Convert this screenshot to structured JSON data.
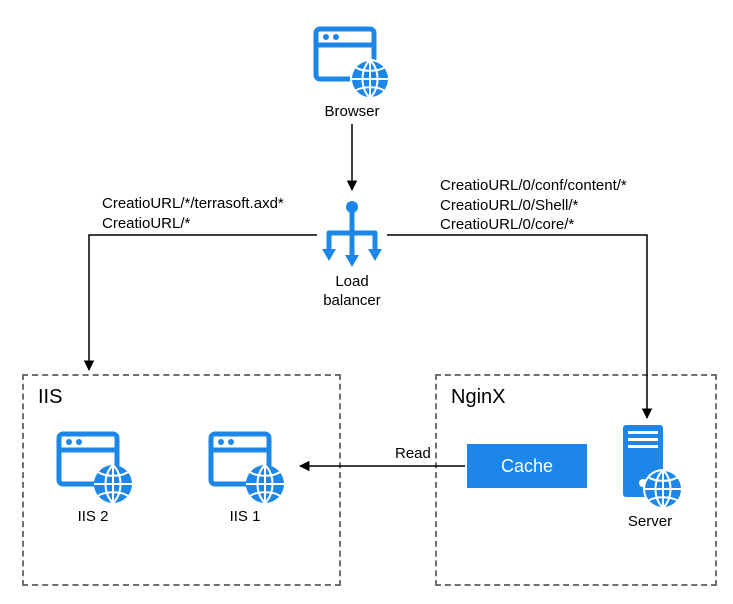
{
  "colors": {
    "blue": "#1C87E8",
    "darkblue": "#1778CF",
    "black": "#000",
    "gray": "#707070"
  },
  "nodes": {
    "browser": {
      "label": "Browser"
    },
    "loadBalancer": {
      "label1": "Load",
      "label2": "balancer"
    },
    "iisGroup": {
      "label": "IIS"
    },
    "iis1": {
      "label": "IIS 1"
    },
    "iis2": {
      "label": "IIS 2"
    },
    "nginxGroup": {
      "label": "NginX"
    },
    "cache": {
      "label": "Cache"
    },
    "server": {
      "label": "Server"
    }
  },
  "routes": {
    "left1": "CreatioURL/*/terrasoft.axd*",
    "left2": "CreatioURL/*",
    "right1": "CreatioURL/0/conf/content/*",
    "right2": "CreatioURL/0/Shell/*",
    "right3": "CreatioURL/0/core/*",
    "read": "Read"
  }
}
